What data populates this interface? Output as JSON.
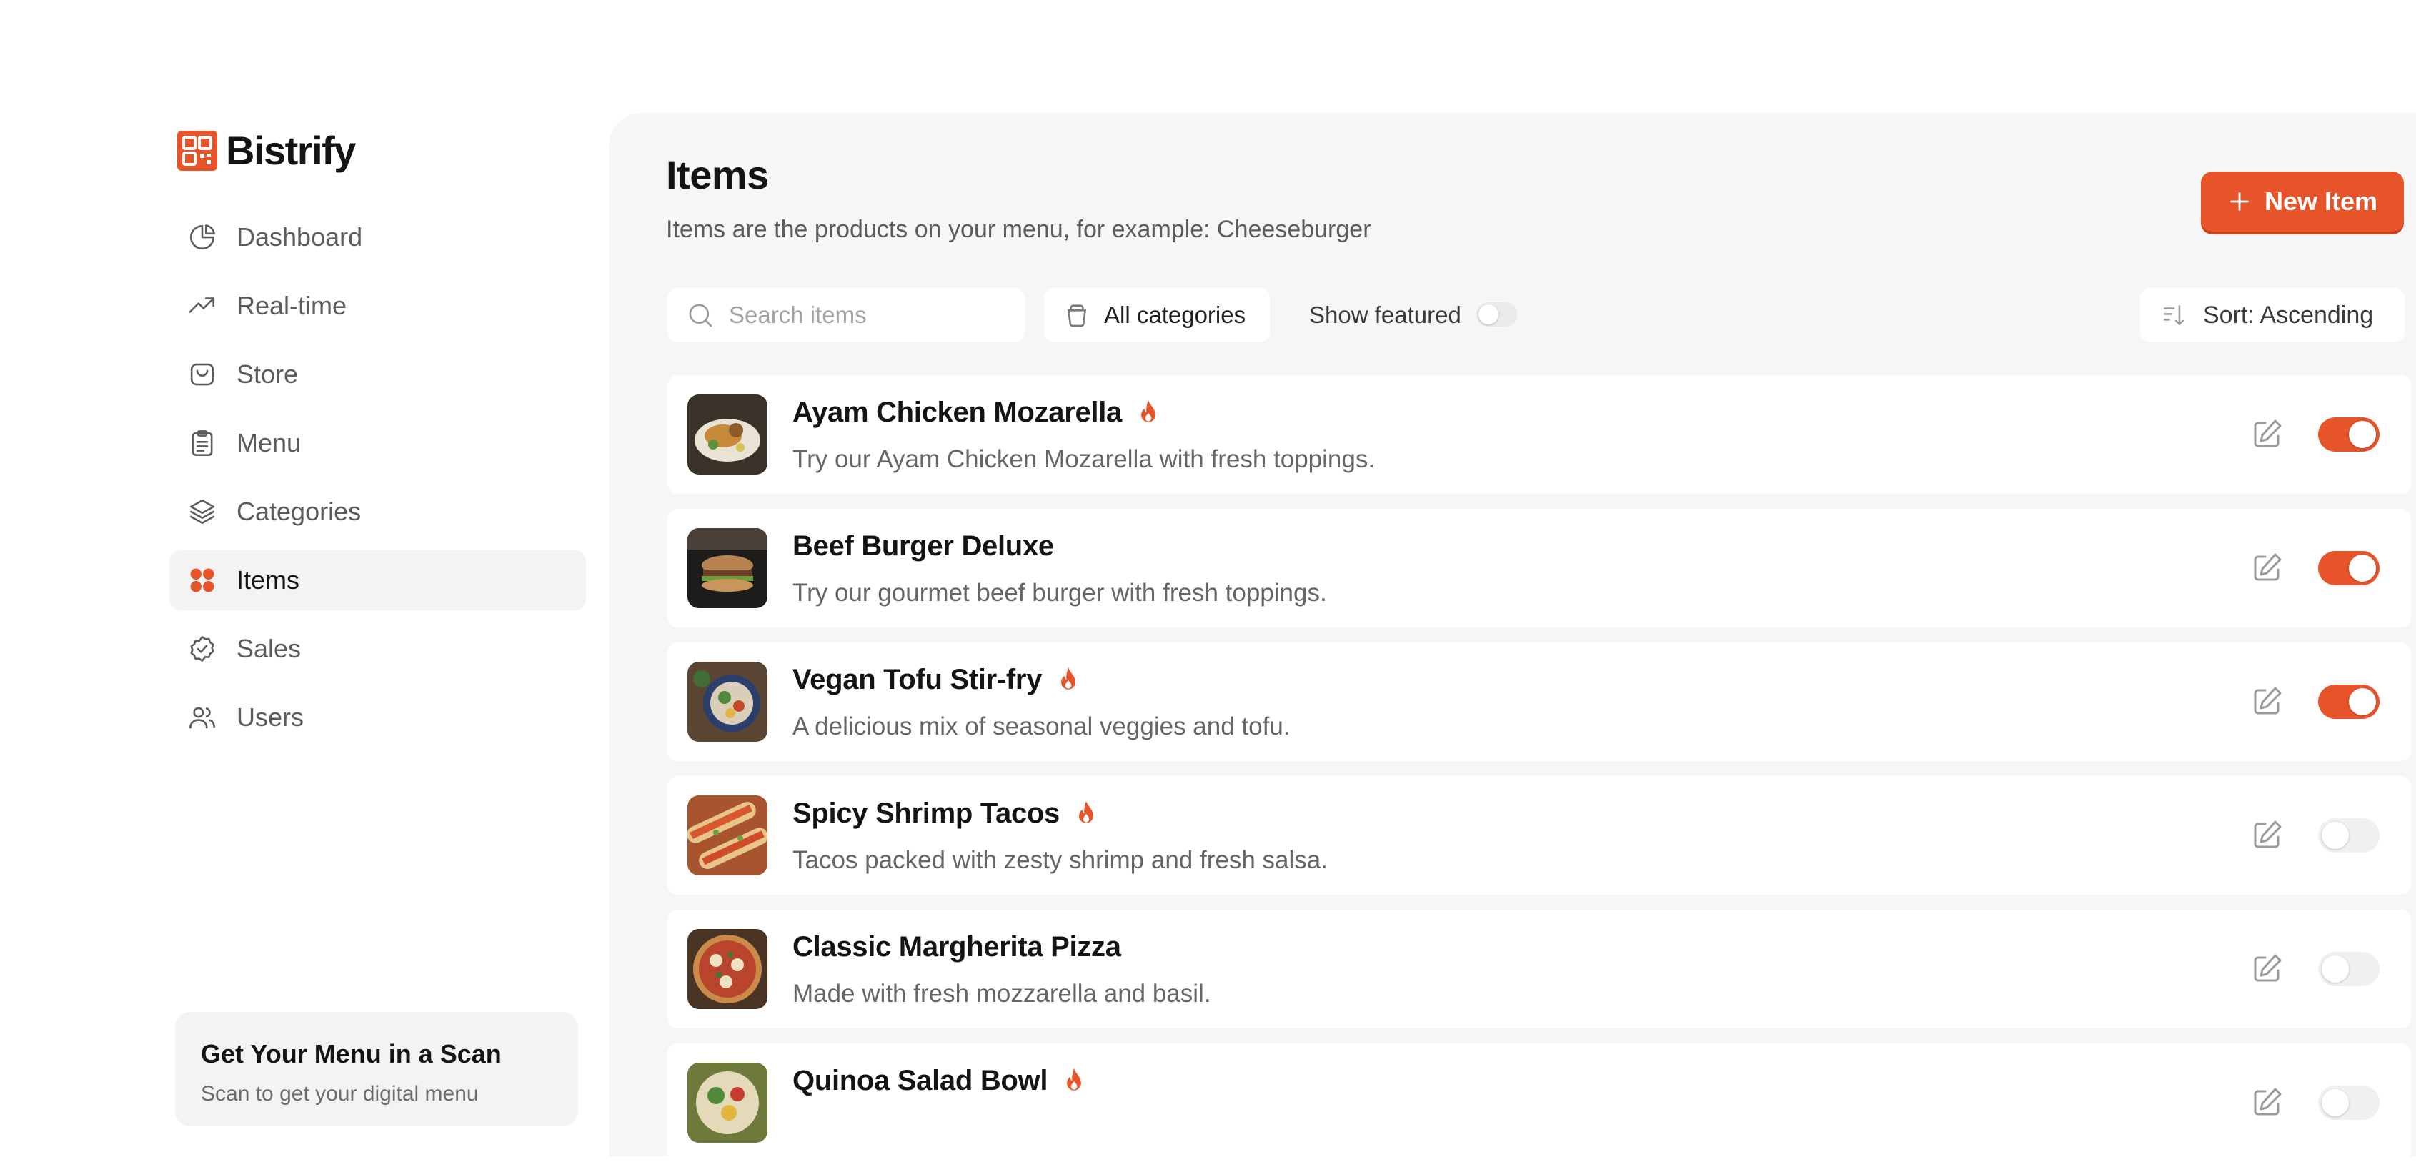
{
  "app": {
    "name": "Bistrify"
  },
  "sidebar": {
    "items": [
      {
        "label": "Dashboard",
        "icon": "pie-chart-icon",
        "active": false
      },
      {
        "label": "Real-time",
        "icon": "trend-up-icon",
        "active": false
      },
      {
        "label": "Store",
        "icon": "bag-icon",
        "active": false
      },
      {
        "label": "Menu",
        "icon": "clipboard-icon",
        "active": false
      },
      {
        "label": "Categories",
        "icon": "layers-icon",
        "active": false
      },
      {
        "label": "Items",
        "icon": "grid-icon",
        "active": true
      },
      {
        "label": "Sales",
        "icon": "badge-check-icon",
        "active": false
      },
      {
        "label": "Users",
        "icon": "users-icon",
        "active": false
      }
    ],
    "promo": {
      "title": "Get Your Menu in a Scan",
      "text": "Scan to get your digital menu"
    }
  },
  "page": {
    "title": "Items",
    "subtitle": "Items are the products on your menu, for example: Cheeseburger",
    "new_button": "New Item"
  },
  "toolbar": {
    "search_placeholder": "Search items",
    "categories_label": "All categories",
    "show_featured_label": "Show featured",
    "show_featured_on": false,
    "sort_label": "Sort: Ascending"
  },
  "items": [
    {
      "name": "Ayam Chicken Mozarella",
      "description": "Try our Ayam Chicken Mozarella with fresh toppings.",
      "featured": true,
      "enabled": true
    },
    {
      "name": "Beef Burger Deluxe",
      "description": "Try our gourmet beef burger with fresh toppings.",
      "featured": false,
      "enabled": true
    },
    {
      "name": "Vegan Tofu Stir-fry",
      "description": "A delicious mix of seasonal veggies and tofu.",
      "featured": true,
      "enabled": true
    },
    {
      "name": "Spicy Shrimp Tacos",
      "description": "Tacos packed with zesty shrimp and fresh salsa.",
      "featured": true,
      "enabled": false
    },
    {
      "name": "Classic Margherita Pizza",
      "description": "Made with fresh mozzarella and basil.",
      "featured": false,
      "enabled": false
    },
    {
      "name": "Quinoa Salad Bowl",
      "description": "",
      "featured": true,
      "enabled": false
    }
  ],
  "colors": {
    "accent": "#e8542a",
    "panel": "#f7f6f6",
    "active_nav": "#f4f3f3"
  }
}
